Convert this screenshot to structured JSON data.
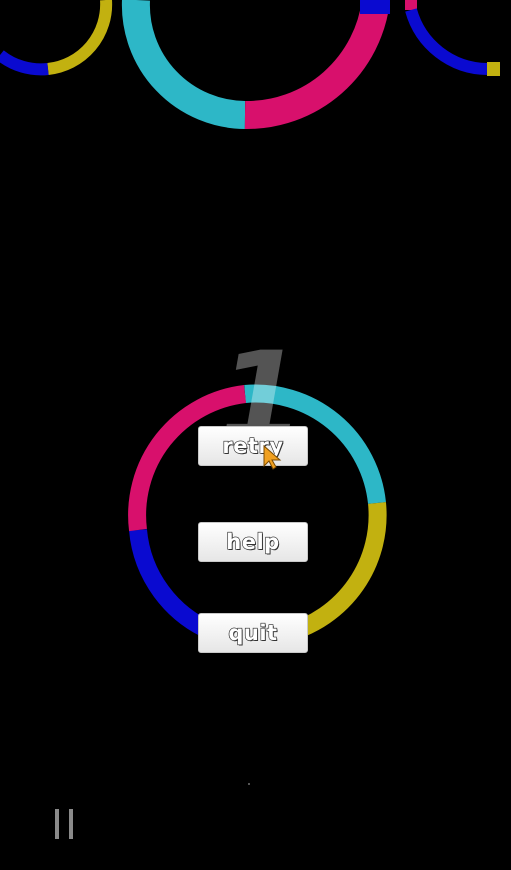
{
  "colors": {
    "cyan": "#2db7c7",
    "magenta": "#d8106c",
    "yellow": "#c2b110",
    "blue": "#0a0ad0",
    "background": "#000000"
  },
  "score": "1",
  "menu": {
    "retry_label": "retry",
    "help_label": "help",
    "quit_label": "quit"
  },
  "icons": {
    "cursor": "mouse-pointer-icon",
    "pause": "pause-icon"
  }
}
